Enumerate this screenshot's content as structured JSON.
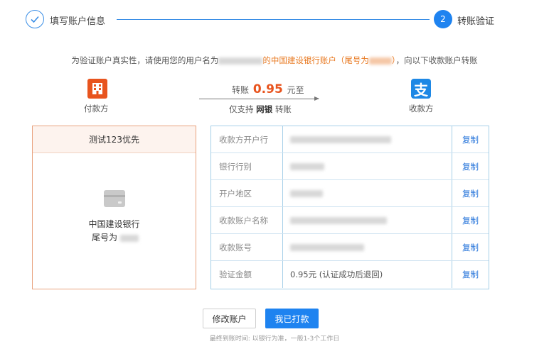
{
  "stepper": {
    "step1_label": "填写账户信息",
    "step2_number": "2",
    "step2_label": "转账验证"
  },
  "instruction": {
    "prefix": "为验证账户真实性，请使用您的用户名为",
    "bank_account_text": "的中国建设银行账户（尾号为",
    "suffix": "，向以下收款账户转账"
  },
  "transfer": {
    "payer_label": "付款方",
    "payee_label": "收款方",
    "payee_icon_char": "支",
    "amount_prefix": "转账",
    "amount": "0.95",
    "amount_suffix": "元至",
    "method_prefix": "仅支持",
    "method": "网银",
    "method_suffix": "转账"
  },
  "payer_card": {
    "name": "测试123优先",
    "bank": "中国建设银行",
    "tail_label": "尾号为"
  },
  "payee_table": {
    "copy_label": "复制",
    "rows": [
      {
        "label": "收款方开户行",
        "value": ""
      },
      {
        "label": "银行行别",
        "value": ""
      },
      {
        "label": "开户地区",
        "value": ""
      },
      {
        "label": "收款账户名称",
        "value": ""
      },
      {
        "label": "收款账号",
        "value": ""
      },
      {
        "label": "验证金额",
        "value": "0.95元 (认证成功后退回)"
      }
    ]
  },
  "actions": {
    "edit_label": "修改账户",
    "paid_label": "我已打款",
    "footnote": "最终到账时间: 以银行为准，一般1-3个工作日"
  },
  "colors": {
    "primary": "#1e83f0",
    "orange": "#e8541e",
    "card_border": "#e9a27e",
    "table_border": "#a6cfe8"
  }
}
